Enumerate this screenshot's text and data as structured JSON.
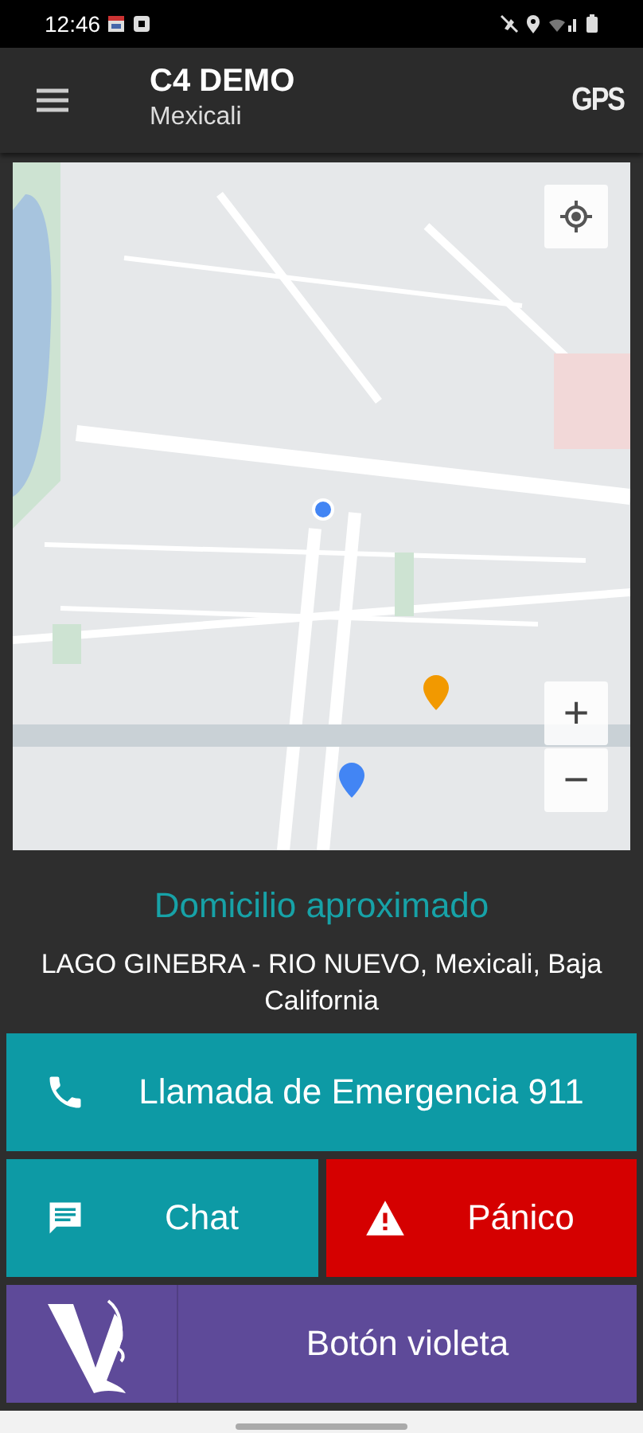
{
  "status_bar": {
    "time": "12:46"
  },
  "app_bar": {
    "title": "C4 DEMO",
    "subtitle": "Mexicali",
    "action": "GPS"
  },
  "map": {
    "kind": "picture",
    "zoom_in": "+",
    "zoom_out": "−"
  },
  "address_label": "Domicilio aproximado",
  "address": "LAGO GINEBRA - RIO NUEVO, Mexicali, Baja California",
  "buttons": [
    {
      "label": "Llamada de Emergencia 911",
      "kind": "call",
      "color": "#0d9aa5"
    },
    {
      "label": "Chat",
      "kind": "chat",
      "color": "#0d9aa5"
    },
    {
      "label": "Pánico",
      "kind": "panic",
      "color": "#d50000"
    },
    {
      "label": "Botón violeta",
      "kind": "violet",
      "color": "#5e4a99"
    }
  ]
}
